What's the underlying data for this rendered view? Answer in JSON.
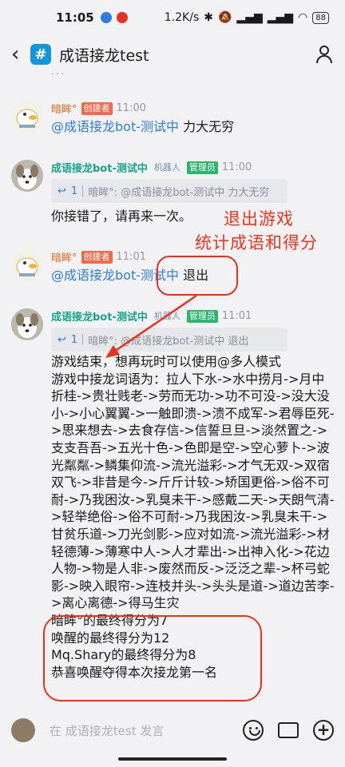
{
  "status": {
    "time": "11:05",
    "network": "1.2K/s",
    "battery": "88"
  },
  "header": {
    "title": "成语接龙test",
    "hash": "#"
  },
  "messages": [
    {
      "name": "暗眸°",
      "role": "创建者",
      "time": "11:00",
      "mention": "@成语接龙bot-测试中",
      "text": "力大无穷"
    },
    {
      "name": "成语接龙bot-测试中",
      "robot": "机器人",
      "role": "管理员",
      "time": "11:00",
      "quote_num": "1",
      "quote": "暗眸°: @成语接龙bot-测试中 力大无穷",
      "text": "你接错了，请再来一次。"
    },
    {
      "name": "暗眸°",
      "role": "创建者",
      "time": "11:01",
      "mention": "@成语接龙bot-测试中",
      "text": "退出"
    },
    {
      "name": "成语接龙bot-测试中",
      "robot": "机器人",
      "role": "管理员",
      "time": "11:01",
      "quote_num": "1",
      "quote": "暗眸°: @成语接龙bot-测试中 退出",
      "text": "游戏结束，想再玩时可以使用@多人模式\n游戏中接龙词语为：拉人下水->水中捞月->月中折桂->贵壮贱老->劳而无功->功不可没->没大没小->小心翼翼->一触即溃->溃不成军->君辱臣死->思来想去->去食存信->信誓旦旦->淡然置之->支支吾吾->五光十色->色即是空->空心萝卜->波光粼粼->鳞集仰流->流光溢彩->才气无双->双宿双飞->非昔是今->斤斤计较->矫国更俗->俗不可耐->乃我困汝->乳臭未干->感戴二天->天朗气清->轻举绝俗->俗不可耐->乃我困汝->乳臭未干->甘贫乐道->刀光剑影->应对如流->流光溢彩->材轻德薄->薄寒中人->人才辈出->出神入化->花边人物->物是人非->废然而反->泛泛之辈->杯弓蛇影->映入眼帘->连枝并头->头头是道->道边苦李->离心离德->得马生灾\n暗眸°的最终得分为7\n唤醒的最终得分为12\nMq.Shary的最终得分为8\n恭喜唤醒夺得本次接龙第一名"
    }
  ],
  "annotation": {
    "line1": "退出游戏",
    "line2": "统计成语和得分",
    "color": "#f0341e"
  },
  "input": {
    "placeholder": "在 成语接龙test 发言"
  },
  "colors": {
    "accent": "#2f7de1",
    "bot_name": "#17a589",
    "user_name": "#e06a1e"
  }
}
